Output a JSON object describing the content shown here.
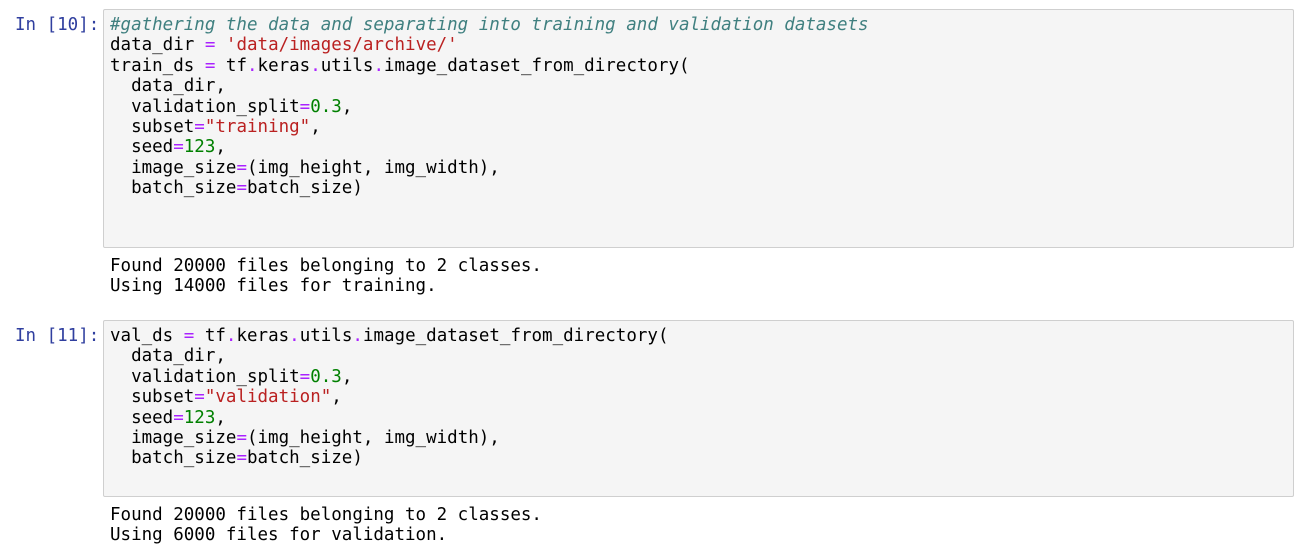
{
  "cells": [
    {
      "prompt": "In [10]:",
      "code_lines": [
        [
          {
            "t": "#gathering the data and separating into training and validation datasets",
            "c": "comment"
          }
        ],
        [
          {
            "t": "data_dir ",
            "c": "name"
          },
          {
            "t": "=",
            "c": "op"
          },
          {
            "t": " ",
            "c": "name"
          },
          {
            "t": "'data/images/archive/'",
            "c": "string"
          }
        ],
        [
          {
            "t": "train_ds ",
            "c": "name"
          },
          {
            "t": "=",
            "c": "op"
          },
          {
            "t": " tf",
            "c": "name"
          },
          {
            "t": ".",
            "c": "op"
          },
          {
            "t": "keras",
            "c": "name"
          },
          {
            "t": ".",
            "c": "op"
          },
          {
            "t": "utils",
            "c": "name"
          },
          {
            "t": ".",
            "c": "op"
          },
          {
            "t": "image_dataset_from_directory(",
            "c": "name"
          }
        ],
        [
          {
            "t": "  data_dir,",
            "c": "name"
          }
        ],
        [
          {
            "t": "  validation_split",
            "c": "name"
          },
          {
            "t": "=",
            "c": "op"
          },
          {
            "t": "0.3",
            "c": "number"
          },
          {
            "t": ",",
            "c": "name"
          }
        ],
        [
          {
            "t": "  subset",
            "c": "name"
          },
          {
            "t": "=",
            "c": "op"
          },
          {
            "t": "\"training\"",
            "c": "string"
          },
          {
            "t": ",",
            "c": "name"
          }
        ],
        [
          {
            "t": "  seed",
            "c": "name"
          },
          {
            "t": "=",
            "c": "op"
          },
          {
            "t": "123",
            "c": "number"
          },
          {
            "t": ",",
            "c": "name"
          }
        ],
        [
          {
            "t": "  image_size",
            "c": "name"
          },
          {
            "t": "=",
            "c": "op"
          },
          {
            "t": "(img_height, img_width),",
            "c": "name"
          }
        ],
        [
          {
            "t": "  batch_size",
            "c": "name"
          },
          {
            "t": "=",
            "c": "op"
          },
          {
            "t": "batch_size)",
            "c": "name"
          }
        ]
      ],
      "output_lines": [
        "Found 20000 files belonging to 2 classes.",
        "Using 14000 files for training."
      ]
    },
    {
      "prompt": "In [11]:",
      "code_lines": [
        [
          {
            "t": "val_ds ",
            "c": "name"
          },
          {
            "t": "=",
            "c": "op"
          },
          {
            "t": " tf",
            "c": "name"
          },
          {
            "t": ".",
            "c": "op"
          },
          {
            "t": "keras",
            "c": "name"
          },
          {
            "t": ".",
            "c": "op"
          },
          {
            "t": "utils",
            "c": "name"
          },
          {
            "t": ".",
            "c": "op"
          },
          {
            "t": "image_dataset_from_directory(",
            "c": "name"
          }
        ],
        [
          {
            "t": "  data_dir,",
            "c": "name"
          }
        ],
        [
          {
            "t": "  validation_split",
            "c": "name"
          },
          {
            "t": "=",
            "c": "op"
          },
          {
            "t": "0.3",
            "c": "number"
          },
          {
            "t": ",",
            "c": "name"
          }
        ],
        [
          {
            "t": "  subset",
            "c": "name"
          },
          {
            "t": "=",
            "c": "op"
          },
          {
            "t": "\"validation\"",
            "c": "string"
          },
          {
            "t": ",",
            "c": "name"
          }
        ],
        [
          {
            "t": "  seed",
            "c": "name"
          },
          {
            "t": "=",
            "c": "op"
          },
          {
            "t": "123",
            "c": "number"
          },
          {
            "t": ",",
            "c": "name"
          }
        ],
        [
          {
            "t": "  image_size",
            "c": "name"
          },
          {
            "t": "=",
            "c": "op"
          },
          {
            "t": "(img_height, img_width),",
            "c": "name"
          }
        ],
        [
          {
            "t": "  batch_size",
            "c": "name"
          },
          {
            "t": "=",
            "c": "op"
          },
          {
            "t": "batch_size)",
            "c": "name"
          }
        ]
      ],
      "output_lines": [
        "Found 20000 files belonging to 2 classes.",
        "Using 6000 files for validation."
      ]
    }
  ],
  "colors": {
    "prompt": "#303f9f",
    "comment": "#408080",
    "string": "#ba2121",
    "number": "#008000",
    "operator": "#aa22ff",
    "cell_background": "#f5f5f5",
    "cell_border": "#cfcfcf"
  }
}
